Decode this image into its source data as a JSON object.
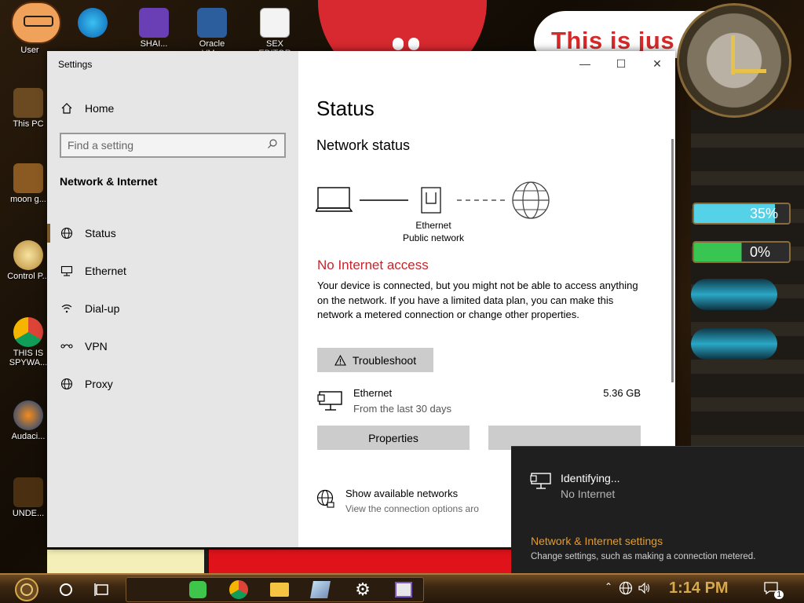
{
  "desktop": {
    "icons": [
      {
        "label": "User"
      },
      {
        "label": "SHAI..."
      },
      {
        "label": "Oracle VM..."
      },
      {
        "label": "SEX EDITOR"
      },
      {
        "label": "This PC"
      },
      {
        "label": "moon g..."
      },
      {
        "label": "Control P..."
      },
      {
        "label": "THIS IS SPYWA..."
      },
      {
        "label": "Audaci..."
      },
      {
        "label": "UNDE..."
      }
    ],
    "banner_text": "This is jus",
    "gauges": [
      {
        "label": "35%",
        "level": 0.35
      },
      {
        "label": "0%",
        "level": 0.0
      }
    ]
  },
  "settings": {
    "window_title": "Settings",
    "controls": {
      "minimize": "—",
      "maximize": "☐",
      "close": "✕"
    },
    "home_label": "Home",
    "search_placeholder": "Find a setting",
    "section_title": "Network & Internet",
    "nav_items": [
      {
        "label": "Status",
        "icon": "globe-icon",
        "active": true
      },
      {
        "label": "Ethernet",
        "icon": "ethernet-icon",
        "active": false
      },
      {
        "label": "Dial-up",
        "icon": "dialup-icon",
        "active": false
      },
      {
        "label": "VPN",
        "icon": "vpn-icon",
        "active": false
      },
      {
        "label": "Proxy",
        "icon": "globe-icon",
        "active": false
      }
    ],
    "page_title": "Status",
    "network_status_title": "Network status",
    "diagram_caption_line1": "Ethernet",
    "diagram_caption_line2": "Public network",
    "alert_title": "No Internet access",
    "alert_desc": "Your device is connected, but you might not be able to access anything on the network. If you have a limited data plan, you can make this network a metered connection or change other properties.",
    "troubleshoot_label": "Troubleshoot",
    "usage": {
      "name": "Ethernet",
      "sub": "From the last 30 days",
      "value": "5.36 GB"
    },
    "properties_label": "Properties",
    "data_usage_label": "",
    "show_networks": {
      "title": "Show available networks",
      "sub": "View the connection options aro"
    }
  },
  "flyout": {
    "status": "Identifying...",
    "sub": "No Internet",
    "link": "Network & Internet settings",
    "desc": "Change settings, such as making a connection metered."
  },
  "taskbar": {
    "time": "1:14 PM",
    "notification_count": "1"
  },
  "colors": {
    "accent_link": "#e89b25",
    "alert_red": "#c4262e",
    "nav_active": "#7a5a2a"
  }
}
